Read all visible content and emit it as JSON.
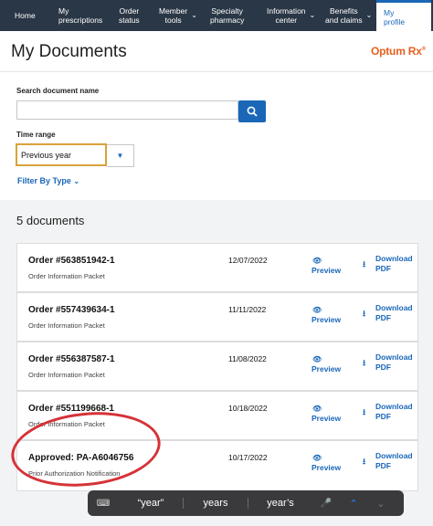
{
  "nav": {
    "items": [
      {
        "label": "Home",
        "chevron": false,
        "active": false
      },
      {
        "label": "My\nprescriptions",
        "chevron": false,
        "active": false
      },
      {
        "label": "Order\nstatus",
        "chevron": false,
        "active": false
      },
      {
        "label": "Member\ntools",
        "chevron": true,
        "active": false
      },
      {
        "label": "Specialty\npharmacy",
        "chevron": false,
        "active": false
      },
      {
        "label": "Information\ncenter",
        "chevron": true,
        "active": false
      },
      {
        "label": "Benefits\nand claims",
        "chevron": true,
        "active": false
      },
      {
        "label": "My\nprofile",
        "chevron": false,
        "active": true
      }
    ]
  },
  "header": {
    "title": "My Documents",
    "logo": "Optum Rx",
    "logo_mark": "®"
  },
  "filters": {
    "search_label": "Search document name",
    "search_value": "",
    "time_label": "Time range",
    "time_value": "Previous year",
    "filter_by_type": "Filter By Type"
  },
  "results": {
    "count_label": "5 documents",
    "documents": [
      {
        "title": "Order #563851942-1",
        "subtitle": "Order Information Packet",
        "date": "12/07/2022",
        "preview": "Preview",
        "download": "Download\nPDF"
      },
      {
        "title": "Order #557439634-1",
        "subtitle": "Order Information Packet",
        "date": "11/11/2022",
        "preview": "Preview",
        "download": "Download\nPDF"
      },
      {
        "title": "Order #556387587-1",
        "subtitle": "Order Information Packet",
        "date": "11/08/2022",
        "preview": "Preview",
        "download": "Download\nPDF"
      },
      {
        "title": "Order #551199668-1",
        "subtitle": "Order Information Packet",
        "date": "10/18/2022",
        "preview": "Preview",
        "download": "Download\nPDF"
      },
      {
        "title": "Approved: PA-A6046756",
        "subtitle": "Prior Authorization Notification",
        "date": "10/17/2022",
        "preview": "Preview",
        "download": "Download\nPDF"
      }
    ]
  },
  "keyboard": {
    "suggestions": [
      "“year”",
      "years",
      "year’s"
    ]
  },
  "colors": {
    "nav_bg": "#2a3746",
    "accent": "#1a67b8",
    "logo": "#e5601f",
    "annotation": "#d63238"
  }
}
